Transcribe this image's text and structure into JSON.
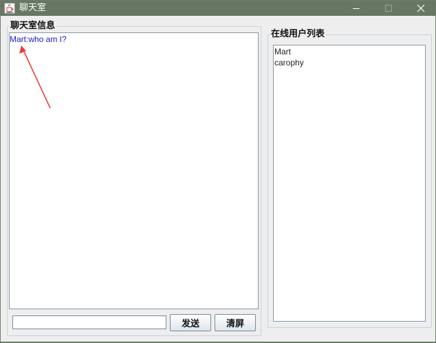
{
  "window": {
    "title": "聊天室"
  },
  "chat": {
    "group_title": "聊天室信息",
    "messages": [
      "Mart:who am I?"
    ],
    "input_value": "",
    "send_label": "发送",
    "clear_label": "清屏"
  },
  "users": {
    "group_title": "在线用户列表",
    "items": [
      "Mart",
      "carophy"
    ]
  },
  "colors": {
    "titlebar": "#677764",
    "message_text": "#1a1acc",
    "annotation_arrow": "#e8403a"
  },
  "icons": {
    "app": "java-coffee-cup-icon",
    "minimize": "minimize-icon",
    "maximize": "maximize-icon",
    "close": "close-icon"
  }
}
